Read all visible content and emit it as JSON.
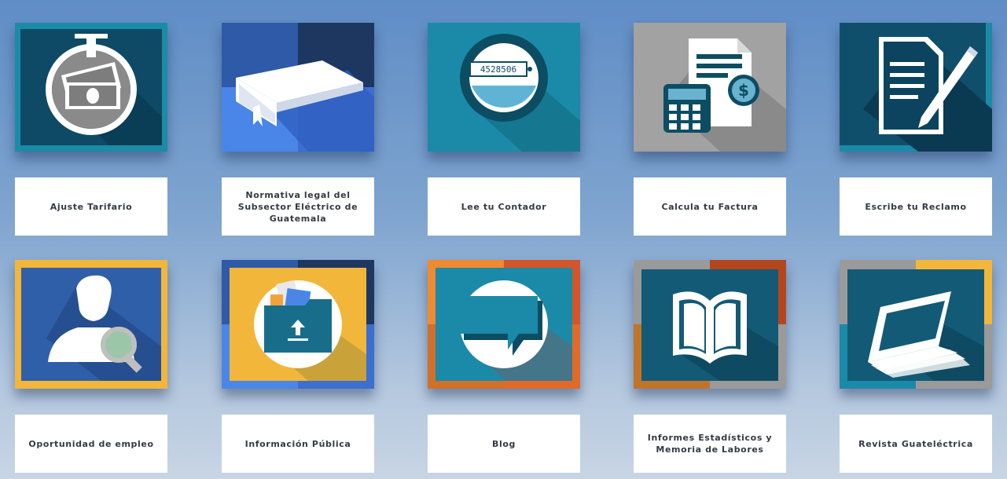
{
  "tiles": [
    {
      "label": "Ajuste Tarifario",
      "icon": "tariff-money-icon"
    },
    {
      "label": "Normativa legal del Subsector Eléctrico de Guatemala",
      "icon": "book-icon"
    },
    {
      "label": "Lee tu Contador",
      "icon": "electric-meter-icon",
      "meter_reading": "4528506"
    },
    {
      "label": "Calcula tu Factura",
      "icon": "calculator-invoice-icon"
    },
    {
      "label": "Escribe tu Reclamo",
      "icon": "document-pen-icon"
    },
    {
      "label": "Oportunidad de empleo",
      "icon": "person-magnifier-icon"
    },
    {
      "label": "Información Pública",
      "icon": "folder-upload-icon"
    },
    {
      "label": "Blog",
      "icon": "chat-bubble-icon"
    },
    {
      "label": "Informes Estadísticos y Memoria de Labores",
      "icon": "open-book-icon"
    },
    {
      "label": "Revista Guateléctrica",
      "icon": "magazine-icon"
    }
  ],
  "colors": {
    "teal_dark": "#0e4c6a",
    "teal": "#1a8aa8",
    "blue": "#2e6fd6",
    "yellow": "#f2b63a",
    "orange": "#e0612a",
    "gray": "#9a9a9a",
    "label_text": "#333a44"
  }
}
